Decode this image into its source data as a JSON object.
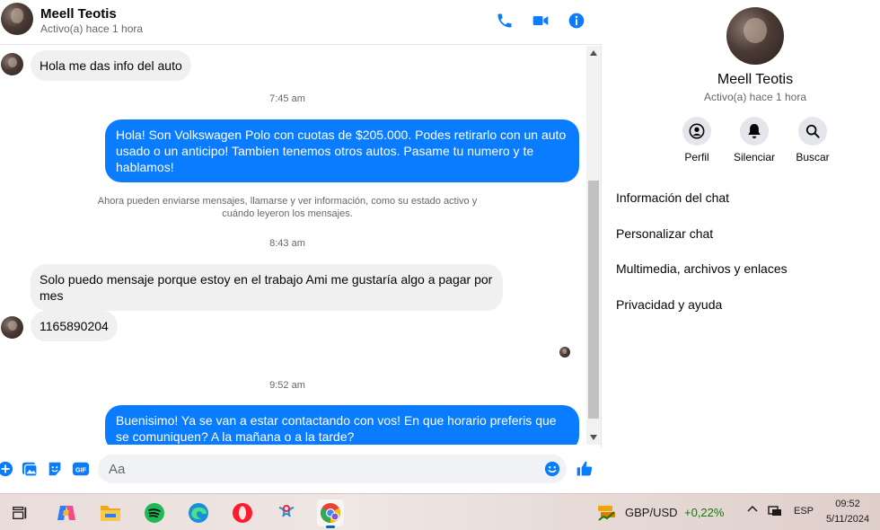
{
  "header": {
    "name": "Meell Teotis",
    "status": "Activo(a) hace 1 hora"
  },
  "colors": {
    "accent": "#0a7cff",
    "bubble_in": "#f0f0f0",
    "text_secondary": "#65676b"
  },
  "messages": {
    "m1": "Hola me das info del auto",
    "t1": "7:45 am",
    "m2": "Hola! Son Volkswagen Polo con cuotas de $205.000. Podes retirarlo con un auto usado o un anticipo! Tambien tenemos otros autos. Pasame tu numero y te hablamos!",
    "system": "Ahora pueden enviarse mensajes, llamarse y ver información, como su estado activo y cuándo leyeron los mensajes.",
    "t2": "8:43 am",
    "m3": "Solo puedo mensaje porque estoy en el trabajo Ami me gustaría algo a pagar por mes",
    "m4": "1165890204",
    "t3": "9:52 am",
    "m5": "Buenisimo! Ya se van a estar contactando con vos! En que horario preferis que se comuniquen? A la mañana o a la tarde?"
  },
  "composer": {
    "placeholder": "Aa"
  },
  "panel": {
    "name": "Meell Teotis",
    "status": "Activo(a) hace 1 hora",
    "actions": [
      "Perfil",
      "Silenciar",
      "Buscar"
    ],
    "items": [
      "Información del chat",
      "Personalizar chat",
      "Multimedia, archivos y enlaces",
      "Privacidad y ayuda"
    ]
  },
  "taskbar": {
    "ticker_label": "GBP/USD",
    "ticker_value": "+0,22%",
    "lang": "ESP",
    "time": "09:52",
    "date": "5/11/2024"
  }
}
